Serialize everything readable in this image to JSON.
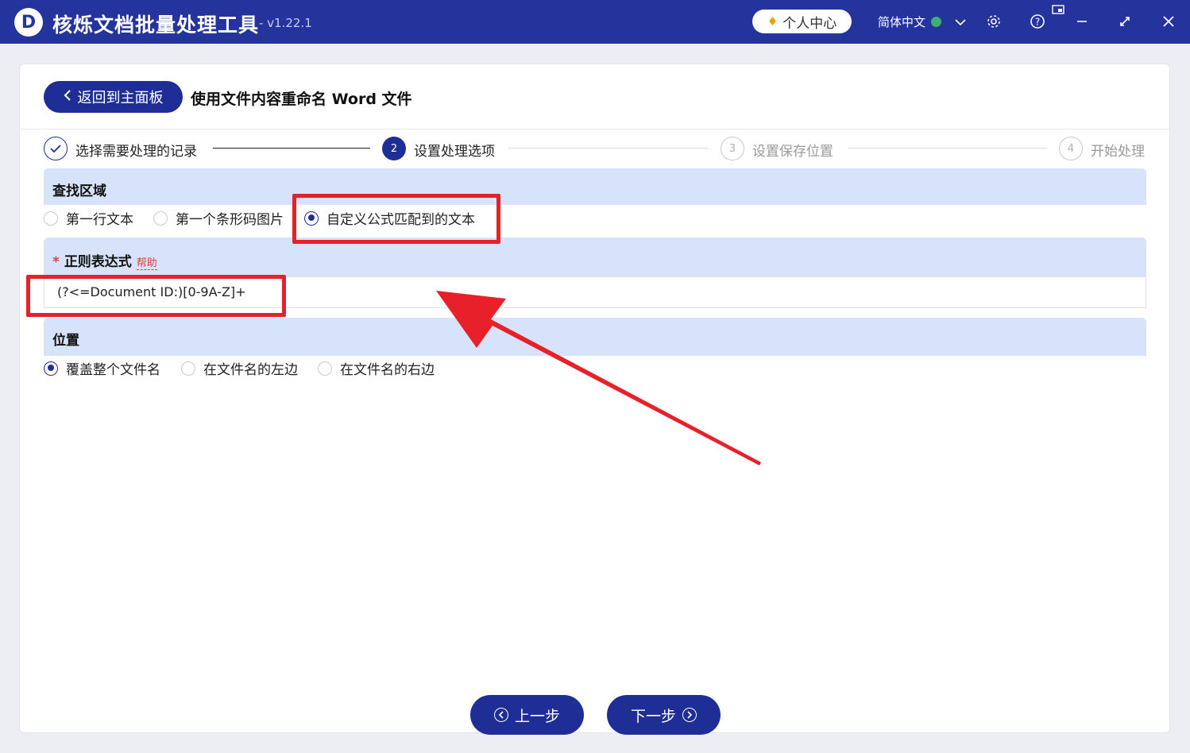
{
  "app": {
    "logo_letter": "D",
    "title": "核烁文档批量处理工具",
    "version": "- v1.22.1",
    "user_center": "个人中心",
    "language": "简体中文"
  },
  "header": {
    "back_label": "返回到主面板",
    "page_title": "使用文件内容重命名 Word 文件"
  },
  "steps": [
    {
      "num": "1",
      "label": "选择需要处理的记录",
      "state": "done"
    },
    {
      "num": "2",
      "label": "设置处理选项",
      "state": "active"
    },
    {
      "num": "3",
      "label": "设置保存位置",
      "state": "future"
    },
    {
      "num": "4",
      "label": "开始处理",
      "state": "future"
    }
  ],
  "search_area": {
    "title": "查找区域",
    "options": [
      "第一行文本",
      "第一个条形码图片",
      "自定义公式匹配到的文本"
    ],
    "selected_index": 2
  },
  "regex": {
    "required_mark": "*",
    "title": "正则表达式",
    "help": "帮助",
    "value": "(?<=Document ID:)[0-9A-Z]+"
  },
  "position": {
    "title": "位置",
    "options": [
      "覆盖整个文件名",
      "在文件名的左边",
      "在文件名的右边"
    ],
    "selected_index": 0
  },
  "footer": {
    "prev_label": "上一步",
    "next_label": "下一步"
  },
  "colors": {
    "primary": "#1f2e96",
    "titlebar": "#24349c",
    "section_bg": "#d6e3fa",
    "highlight": "#e8202a"
  }
}
